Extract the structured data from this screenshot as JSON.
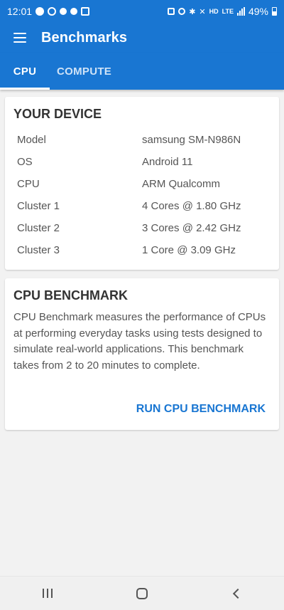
{
  "status_bar": {
    "time": "12:01",
    "hd_label": "HD",
    "lte_label": "LTE",
    "battery_percent": "49%"
  },
  "app_bar": {
    "title": "Benchmarks"
  },
  "tabs": [
    {
      "label": "CPU",
      "active": true
    },
    {
      "label": "COMPUTE",
      "active": false
    }
  ],
  "device_card": {
    "title": "YOUR DEVICE",
    "rows": [
      {
        "key": "Model",
        "value": "samsung SM-N986N"
      },
      {
        "key": "OS",
        "value": "Android 11"
      },
      {
        "key": "CPU",
        "value": "ARM Qualcomm"
      },
      {
        "key": "Cluster 1",
        "value": "4 Cores @ 1.80 GHz"
      },
      {
        "key": "Cluster 2",
        "value": "3 Cores @ 2.42 GHz"
      },
      {
        "key": "Cluster 3",
        "value": "1 Core @ 3.09 GHz"
      }
    ]
  },
  "benchmark_card": {
    "title": "CPU BENCHMARK",
    "description": "CPU Benchmark measures the performance of CPUs at performing everyday tasks using tests designed to simulate real-world applications. This benchmark takes from 2 to 20 minutes to complete.",
    "action_label": "RUN CPU BENCHMARK"
  },
  "colors": {
    "primary": "#1976d2",
    "background": "#f2f2f2",
    "card": "#ffffff"
  },
  "icons": {
    "status_left": [
      "settings-icon",
      "circle-app-icon",
      "reddit-icon",
      "chat-bubble-icon",
      "image-icon"
    ],
    "status_right": [
      "lock-icon",
      "alarm-icon",
      "bluetooth-icon",
      "mute-icon",
      "signal-icon",
      "battery-icon"
    ],
    "nav": [
      "recents-icon",
      "home-icon",
      "back-icon"
    ]
  }
}
